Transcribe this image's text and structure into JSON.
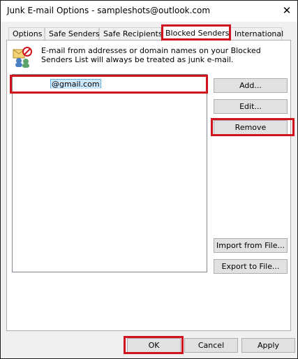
{
  "window": {
    "title": "Junk E-mail Options - sampleshots@outlook.com",
    "close_glyph": "✕"
  },
  "tabs": [
    {
      "label": "Options"
    },
    {
      "label": "Safe Senders"
    },
    {
      "label": "Safe Recipients"
    },
    {
      "label": "Blocked Senders",
      "active": true
    },
    {
      "label": "International"
    }
  ],
  "info": {
    "icon": "blocked-senders-icon",
    "text": "E-mail from addresses or domain names on your Blocked Senders List will always be treated as junk e-mail."
  },
  "blocked_list": {
    "items": [
      {
        "prefix": ".",
        "email": "@gmail.com",
        "selected": true
      }
    ]
  },
  "side_buttons": {
    "add": "Add...",
    "edit": "Edit...",
    "remove": "Remove",
    "import": "Import from File...",
    "export": "Export to File..."
  },
  "footer": {
    "ok": "OK",
    "cancel": "Cancel",
    "apply": "Apply"
  },
  "colors": {
    "highlight_box": "#d0141e",
    "selection_bg": "#cce8ff"
  }
}
